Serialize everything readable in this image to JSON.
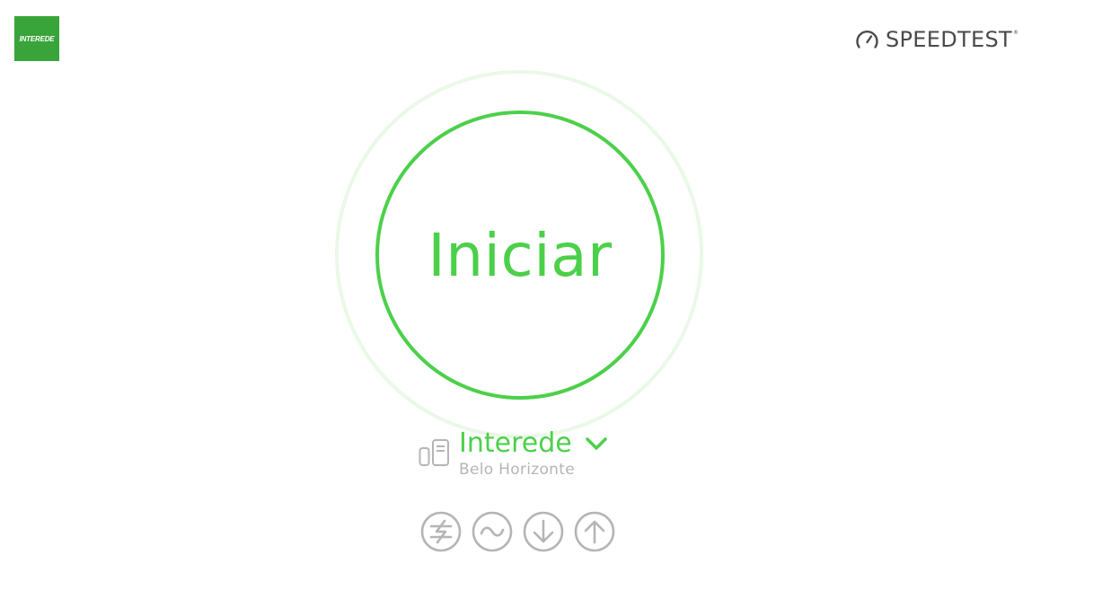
{
  "header": {
    "brand_logo_text": "INTEREDE",
    "speedtest_wordmark": "SPEEDTEST",
    "trademark": "®"
  },
  "go_button": {
    "label": "Iniciar"
  },
  "server": {
    "provider": "Interede",
    "location": "Belo Horizonte"
  },
  "connection_modes": [
    {
      "icon": "multi-connection-icon"
    },
    {
      "icon": "ping-icon"
    },
    {
      "icon": "download-icon"
    },
    {
      "icon": "upload-icon"
    }
  ],
  "colors": {
    "accent_green": "#4cd04a",
    "ring_light": "#eaf8e8",
    "brand_green": "#39a43a",
    "icon_gray": "#b5b5b5",
    "text_dark": "#4a4a4a"
  }
}
